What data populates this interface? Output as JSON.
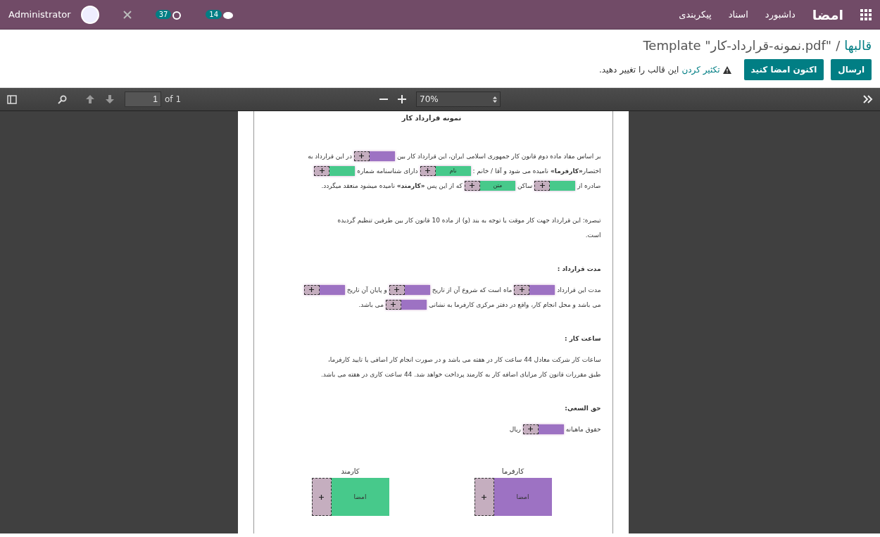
{
  "navbar": {
    "app_name": "امضا",
    "menu": [
      "داشبورد",
      "اسناد",
      "پیکربندی"
    ],
    "user": "Administrator",
    "activity_count": "37",
    "message_count": "14"
  },
  "breadcrumb": {
    "parent": "قالبها",
    "separator": "/",
    "current": "Template \"نمونه-قرارداد-کار.pdf\""
  },
  "actions": {
    "buttons": [
      "ارسال",
      "اکنون امضا کنید"
    ],
    "warning_link": "تکثیر کردن",
    "warning_text": "این قالب را تغییر دهید."
  },
  "pdf_toolbar": {
    "page": "1",
    "page_count": "of 1",
    "zoom": "70%"
  },
  "document": {
    "title": "نمونه قرارداد کار",
    "blocks": [
      {
        "kind": "paragraph",
        "lines": [
          [
            {
              "kind": "text",
              "text": "بر اساس مفاد ماده دوم قانون کار جمهوری اسلامی ایران، این قرارداد کار بین"
            },
            {
              "kind": "field",
              "color": "#9d72c3"
            },
            {
              "kind": "text",
              "text": "در این قرارداد به"
            }
          ],
          [
            {
              "kind": "text",
              "text": "اختصار**«کارفرما»** نامیده می شود و آقا / خانم :"
            },
            {
              "kind": "field",
              "color": "#47c98b",
              "label": "نام"
            },
            {
              "kind": "text",
              "text": "دارای شناسنامه شماره"
            },
            {
              "kind": "field",
              "color": "#47c98b"
            }
          ],
          [
            {
              "kind": "text",
              "text": "صادره از"
            },
            {
              "kind": "field",
              "color": "#47c98b"
            },
            {
              "kind": "text",
              "text": "ساکن"
            },
            {
              "kind": "field",
              "color": "#47c98b",
              "label": "متن"
            },
            {
              "kind": "text",
              "text": "که از این پس **«کارمند»** نامیده میشود منعقد میگردد."
            }
          ]
        ]
      },
      {
        "kind": "paragraph",
        "lines": [
          [
            {
              "kind": "text",
              "text": "تبصره: این قرارداد جهت کار موقت یا توجه به بند (و) از ماده 10 قانون کار بین طرفین تنظیم گردیده"
            }
          ],
          [
            {
              "kind": "text",
              "text": "است."
            }
          ]
        ]
      },
      {
        "kind": "heading",
        "text": "مدت قرارداد :"
      },
      {
        "kind": "paragraph",
        "lines": [
          [
            {
              "kind": "text",
              "text": "مدت این قرارداد"
            },
            {
              "kind": "field",
              "color": "#9d72c3"
            },
            {
              "kind": "text",
              "text": "ماه است که شروع آن از تاریخ"
            },
            {
              "kind": "field",
              "color": "#9d72c3"
            },
            {
              "kind": "text",
              "text": "و پایان آن تاریخ"
            },
            {
              "kind": "field",
              "color": "#9d72c3"
            }
          ],
          [
            {
              "kind": "text",
              "text": "می باشد و محل انجام کار، واقع در دفتر مرکزی کارفرما به نشانی"
            },
            {
              "kind": "field",
              "color": "#9d72c3"
            },
            {
              "kind": "text",
              "text": "می باشد."
            }
          ]
        ]
      },
      {
        "kind": "heading",
        "text": "ساعت کار :"
      },
      {
        "kind": "paragraph",
        "lines": [
          [
            {
              "kind": "text",
              "text": "ساعات کار شرکت معادل 44 ساعت کار در هفته می باشد و در صورت انجام کار اضافی یا تایید کارفرما،"
            }
          ],
          [
            {
              "kind": "text",
              "text": "طبق مقررات قانون کار مزایای اضافه کار به کارمند پرداخت خواهد شد. 44 ساعت کاری در هفته می باشد."
            }
          ]
        ]
      },
      {
        "kind": "heading",
        "text": "حق السعی:"
      },
      {
        "kind": "paragraph",
        "lines": [
          [
            {
              "kind": "text",
              "text": "حقوق ماهیانه"
            },
            {
              "kind": "field",
              "color": "#9d72c3"
            },
            {
              "kind": "text",
              "text": "ریال"
            }
          ]
        ]
      }
    ],
    "signatures": [
      {
        "role": "کارفرما",
        "color": "#9d72c3",
        "label": "امضا"
      },
      {
        "role": "کارمند",
        "color": "#47c98b",
        "label": "امضا"
      }
    ]
  }
}
